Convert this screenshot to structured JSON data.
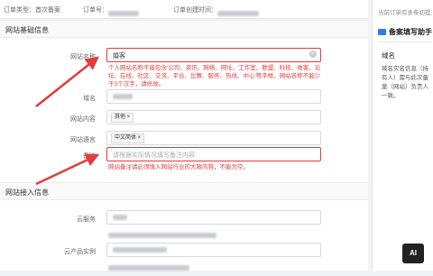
{
  "order": {
    "type_label": "订单类型：首次备案",
    "number_label": "订单号：",
    "created_label": "订单创建时间："
  },
  "sections": {
    "basic": "网站基础信息",
    "access": "网站接入信息"
  },
  "form": {
    "site_name": {
      "label": "网站名称",
      "value": "婚客",
      "error": "个人网站名称不能包含'公司、资讯、网络、网址、工作室、联盟、科技、维客、论坛、在线、社区、交流、平台、比赛、服务、热线、中心'等字样。网站名称不能少于3个汉字，请修改。"
    },
    "domain": {
      "label": "域名"
    },
    "content": {
      "label": "网站内容",
      "tag": "其他"
    },
    "language": {
      "label": "网站语言",
      "tag": "中文简体"
    },
    "remark": {
      "label": "备注",
      "placeholder": "请根据实际情况填写备注内容",
      "error": "网站备注请必须填入网站行业的大致内容，不能为空。"
    },
    "cloud_service": {
      "label": "云服务"
    },
    "cloud_instance": {
      "label": "云产品实例"
    }
  },
  "sidebar": {
    "hint": "当前订单有多条初提交",
    "assistant_title": "备案填写助手",
    "field_title": "域名",
    "description": "域名实名信息（持有人）需与此次备案（网站）负责人一致。"
  },
  "badge": {
    "text": "AI"
  },
  "colors": {
    "error": "#e23c3c",
    "accent": "#2b7de9"
  }
}
